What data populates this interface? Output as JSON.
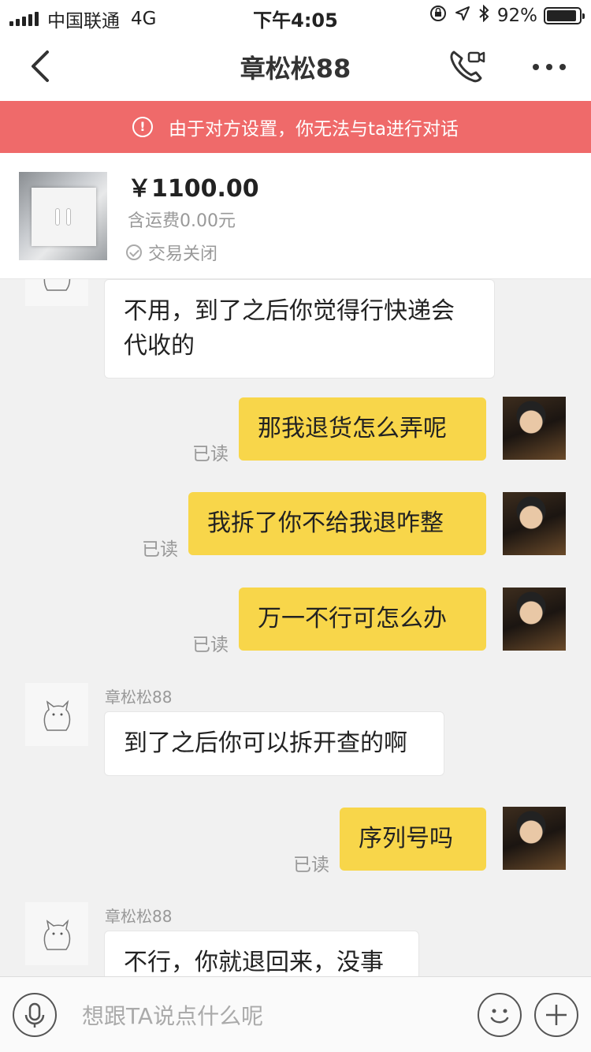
{
  "status_bar": {
    "carrier": "中国联通",
    "network": "4G",
    "time": "下午4:05",
    "battery_text": "92%",
    "battery_level": 0.92
  },
  "nav": {
    "title": "章松松88",
    "icons": [
      "back-chevron-icon",
      "video-call-icon",
      "more-icon"
    ]
  },
  "banner": {
    "text": "由于对方设置，你无法与ta进行对话"
  },
  "product": {
    "price": "￥1100.00",
    "shipping": "含运费0.00元",
    "status": "交易关闭"
  },
  "messages": [
    {
      "side": "in",
      "text_lines": [
        "不用，到了之后你觉得行快递会",
        "代收的"
      ]
    },
    {
      "side": "out",
      "text": "那我退货怎么弄呢",
      "read": "已读"
    },
    {
      "side": "out",
      "text": "我拆了你不给我退咋整",
      "read": "已读"
    },
    {
      "side": "out",
      "text": "万一不行可怎么办",
      "read": "已读"
    },
    {
      "side": "in",
      "sender": "章松松88",
      "text": "到了之后你可以拆开查的啊"
    },
    {
      "side": "out",
      "text": "序列号吗",
      "read": "已读"
    },
    {
      "side": "in",
      "sender": "章松松88",
      "text": "不行，你就退回来，没事"
    }
  ],
  "input": {
    "placeholder": "想跟TA说点什么呢"
  },
  "colors": {
    "banner": "#ef6a6a",
    "outgoing_bubble": "#f8d64a",
    "incoming_bubble": "#ffffff",
    "chat_background": "#f1f1f1"
  }
}
